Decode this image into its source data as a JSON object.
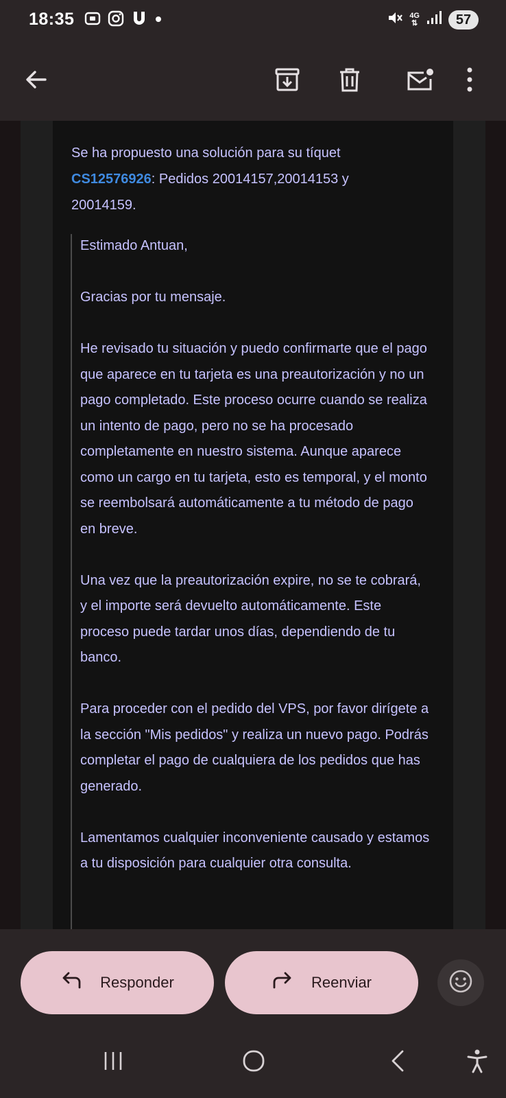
{
  "status_bar": {
    "time": "18:35",
    "network_label": "4G",
    "battery": "57"
  },
  "toolbar": {
    "icons": [
      "back-arrow-icon",
      "archive-icon",
      "delete-icon",
      "mark-unread-icon",
      "more-vert-icon"
    ]
  },
  "email": {
    "intro_prefix": "Se ha propuesto una solución para su tíquet",
    "ticket_id": "CS12576926",
    "intro_suffix": ": Pedidos 20014157,20014153 y 20014159.",
    "quote": [
      "Estimado Antuan,",
      "Gracias por tu mensaje.",
      "He revisado tu situación y puedo confirmarte que el pago que aparece en tu tarjeta es una preautorización y no un pago completado. Este proceso ocurre cuando se realiza un intento de pago, pero no se ha procesado completamente en nuestro sistema. Aunque aparece como un cargo en tu tarjeta, esto es temporal, y el monto se reembolsará automáticamente a tu método de pago en breve.",
      "Una vez que la preautorización expire, no se te cobrará, y el importe será devuelto automáticamente. Este proceso puede tardar unos días, dependiendo de tu banco.",
      "Para proceder con el pedido del VPS, por favor dirígete a la sección \"Mis pedidos\" y realiza un nuevo pago. Podrás completar el pago de cualquiera de los pedidos que has generado.",
      "Lamentamos cualquier inconveniente causado y estamos a tu disposición para cualquier otra consulta."
    ]
  },
  "actions": {
    "reply_label": "Responder",
    "forward_label": "Reenviar"
  },
  "colors": {
    "link": "#3f8ae0",
    "text": "#c6c2ff",
    "pill": "#e8c5ce"
  }
}
